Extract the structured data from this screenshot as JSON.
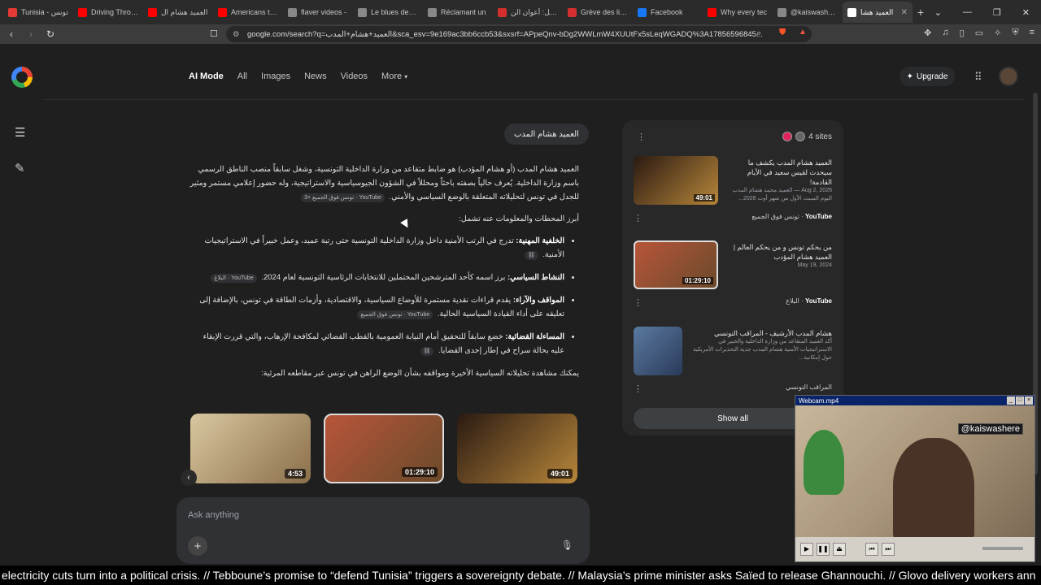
{
  "browser": {
    "tabs": [
      {
        "title": "Tunisia - تونس",
        "color": "#e53935"
      },
      {
        "title": "Driving Throug",
        "color": "#ff0000"
      },
      {
        "title": "العميد هشام ال",
        "color": "#ff0000"
      },
      {
        "title": "Americans told",
        "color": "#ff0000"
      },
      {
        "title": "flaver videos -",
        "color": "#888888"
      },
      {
        "title": "Le blues des lin",
        "color": "#888888"
      },
      {
        "title": "Réclamant un",
        "color": "#888888"
      },
      {
        "title": "عاجل: أعوان الن",
        "color": "#d32f2f"
      },
      {
        "title": "Grève des livre",
        "color": "#d32f2f"
      },
      {
        "title": "Facebook",
        "color": "#1877f2"
      },
      {
        "title": "Why every tec",
        "color": "#ff0000"
      },
      {
        "title": "@kaiswashere",
        "color": "#888888"
      },
      {
        "title": "العميد هشا",
        "color": "#ffffff",
        "active": true
      }
    ],
    "url": "google.com/search?q=العميد+هشام+المدب&sca_esv=9e169ac3bb6ccb53&sxsrf=APpeQnv-bDg2WWLmW4XUUtFx5sLeqWGADQ%3A17856596845..."
  },
  "google": {
    "tabs": [
      "AI Mode",
      "All",
      "Images",
      "News",
      "Videos",
      "More"
    ],
    "upgrade_label": "Upgrade",
    "query": "العميد هشام المدب",
    "intro": "العميد هشام المدب (أو هشام المؤدب) هو ضابط متقاعد من وزارة الداخلية التونسية، وشغل سابقاً منصب الناطق الرسمي باسم وزارة الداخلية. يُعرف حالياً بصفته باحثاً ومحللاً في الشؤون الجيوسياسية والاستراتيجية، وله حضور إعلامي مستمر ومثير للجدل في تونس لتحليلاته المتعلقة بالوضع السياسي والأمني.",
    "intro_chip": "YouTube · تونس فوق الجميع +3",
    "lead": "أبرز المحطات والمعلومات عنه تشمل:",
    "bullets": [
      {
        "bold": "الخلفية المهنية:",
        "text": "تدرج في الرتب الأمنية داخل وزارة الداخلية التونسية حتى رتبة عميد، وعمل خبيراً في الاستراتيجيات الأمنية.",
        "chip": ""
      },
      {
        "bold": "النشاط السياسي:",
        "text": "برز اسمه كأحد المترشحين المحتملين للانتخابات الرئاسية التونسية لعام 2024.",
        "chip": "YouTube · البلاغ"
      },
      {
        "bold": "المواقف والآراء:",
        "text": "يقدم قراءات نقدية مستمرة للأوضاع السياسية، والاقتصادية، وأزمات الطاقة في تونس، بالإضافة إلى تعليقه على أداء القيادة السياسية الحالية.",
        "chip": "YouTube · تونس فوق الجميع"
      },
      {
        "bold": "المساءلة القضائية:",
        "text": "خضع سابقاً للتحقيق أمام النيابة العمومية بالقطب القضائي لمكافحة الإرهاب، والتي قررت الإبقاء عليه بحالة سراح في إطار إحدى القضايا.",
        "chip": ""
      }
    ],
    "outro": "يمكنك مشاهدة تحليلاته السياسية الأخيرة ومواقفه بشأن الوضع الراهن في تونس عبر مقاطعه المرئية:",
    "videos": [
      {
        "duration": "4:53"
      },
      {
        "duration": "01:29:10"
      },
      {
        "duration": "49:01"
      }
    ],
    "ask_placeholder": "Ask anything",
    "sources_label": "4 sites",
    "sources": [
      {
        "title": "العميد هشام المدب يكشف ما سيحدث لقيس سعيد في الأيام القادمة!",
        "snippet": "Aug 2, 2026 — العميد محمد هشام المدب اليوم السبت الأول من شهر أوت 2026...",
        "site": "YouTube",
        "channel": "تونس فوق الجميع",
        "duration": "49:01"
      },
      {
        "title": "من يحكم تونس و من يحكم العالم | العميد هشام المؤدب",
        "snippet": "May 19, 2024",
        "site": "YouTube",
        "channel": "البلاغ",
        "duration": "01:29:10"
      },
      {
        "title": "هشام المدب الأرشيف - المراقب التونسي",
        "snippet": "أكد العميد المتقاعد من وزارة الداخلية والخبير في الاستراتيجيات الأمنية هشام المدب جدية التحذيرات الأمريكية حول إمكانية...",
        "site": "المراقب التونسي",
        "channel": "",
        "duration": ""
      }
    ],
    "show_all": "Show all"
  },
  "webcam": {
    "title": "Webcam.mp4",
    "tag": "@kaiswashere"
  },
  "ticker": "electricity cuts turn into a political crisis. // Tebboune’s promise to “defend Tunisia” triggers a sovereignty debate. // Malaysia’s prime minister asks Saïed to release Ghannouchi. // Glovo delivery workers ann"
}
